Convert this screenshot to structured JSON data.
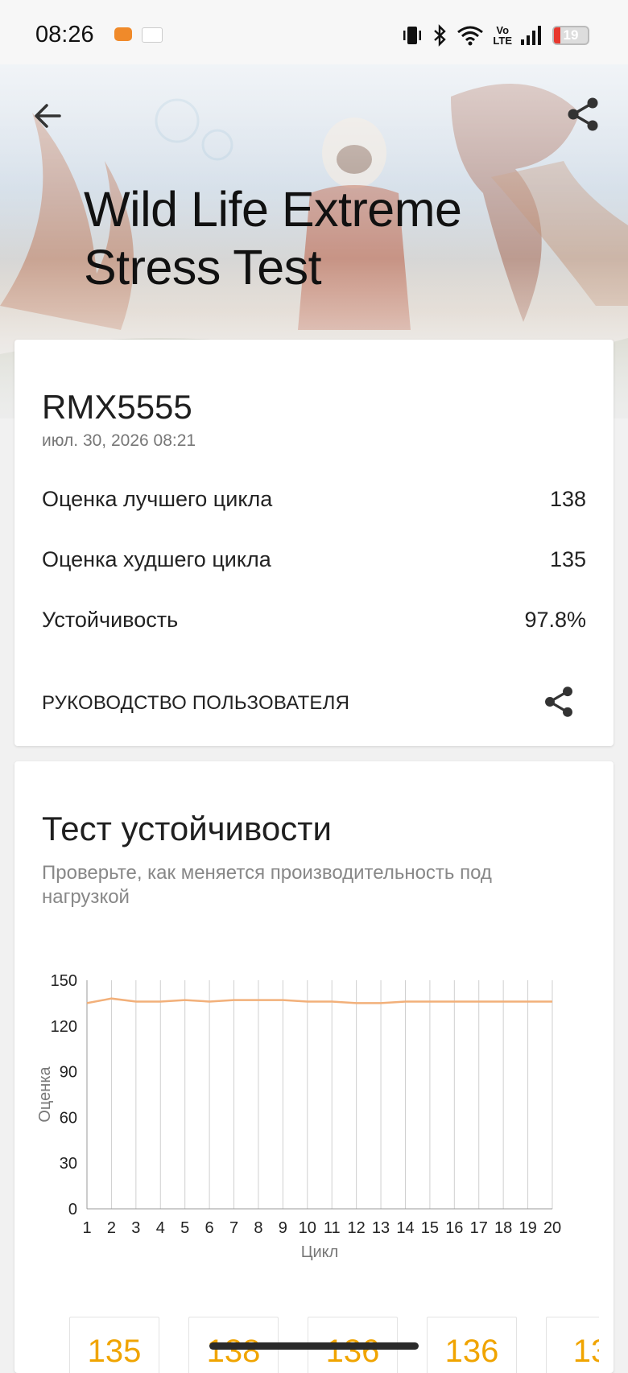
{
  "status_bar": {
    "time": "08:26",
    "volte_top": "Vo",
    "volte_bottom": "LTE",
    "battery_level": "19",
    "battery_fraction": 0.19,
    "battery_color": "#e8382e"
  },
  "hero": {
    "title_line1": "Wild Life Extreme",
    "title_line2": "Stress Test",
    "back_icon": "arrow-left-icon",
    "share_icon": "share-icon"
  },
  "result": {
    "device": "RMX5555",
    "date": "июл. 30, 2026 08:21",
    "rows": [
      {
        "label": "Оценка лучшего цикла",
        "value": "138"
      },
      {
        "label": "Оценка худшего цикла",
        "value": "135"
      },
      {
        "label": "Устойчивость",
        "value": "97.8%"
      }
    ],
    "guide_label": "РУКОВОДСТВО ПОЛЬЗОВАТЕЛЯ"
  },
  "stability": {
    "title": "Тест устойчивости",
    "subtitle": "Проверьте, как меняется производительность под нагрузкой"
  },
  "chart_data": {
    "type": "line",
    "xlabel": "Цикл",
    "ylabel": "Оценка",
    "x": [
      1,
      2,
      3,
      4,
      5,
      6,
      7,
      8,
      9,
      10,
      11,
      12,
      13,
      14,
      15,
      16,
      17,
      18,
      19,
      20
    ],
    "y": [
      135,
      138,
      136,
      136,
      137,
      136,
      137,
      137,
      137,
      136,
      136,
      135,
      135,
      136,
      136,
      136,
      136,
      136,
      136,
      136
    ],
    "ylim": [
      0,
      150
    ],
    "yticks": [
      0,
      30,
      60,
      90,
      120,
      150
    ],
    "grid": "vertical",
    "line_color": "#f2b07a"
  },
  "tiles": [
    "135",
    "138",
    "136",
    "136",
    "13"
  ]
}
